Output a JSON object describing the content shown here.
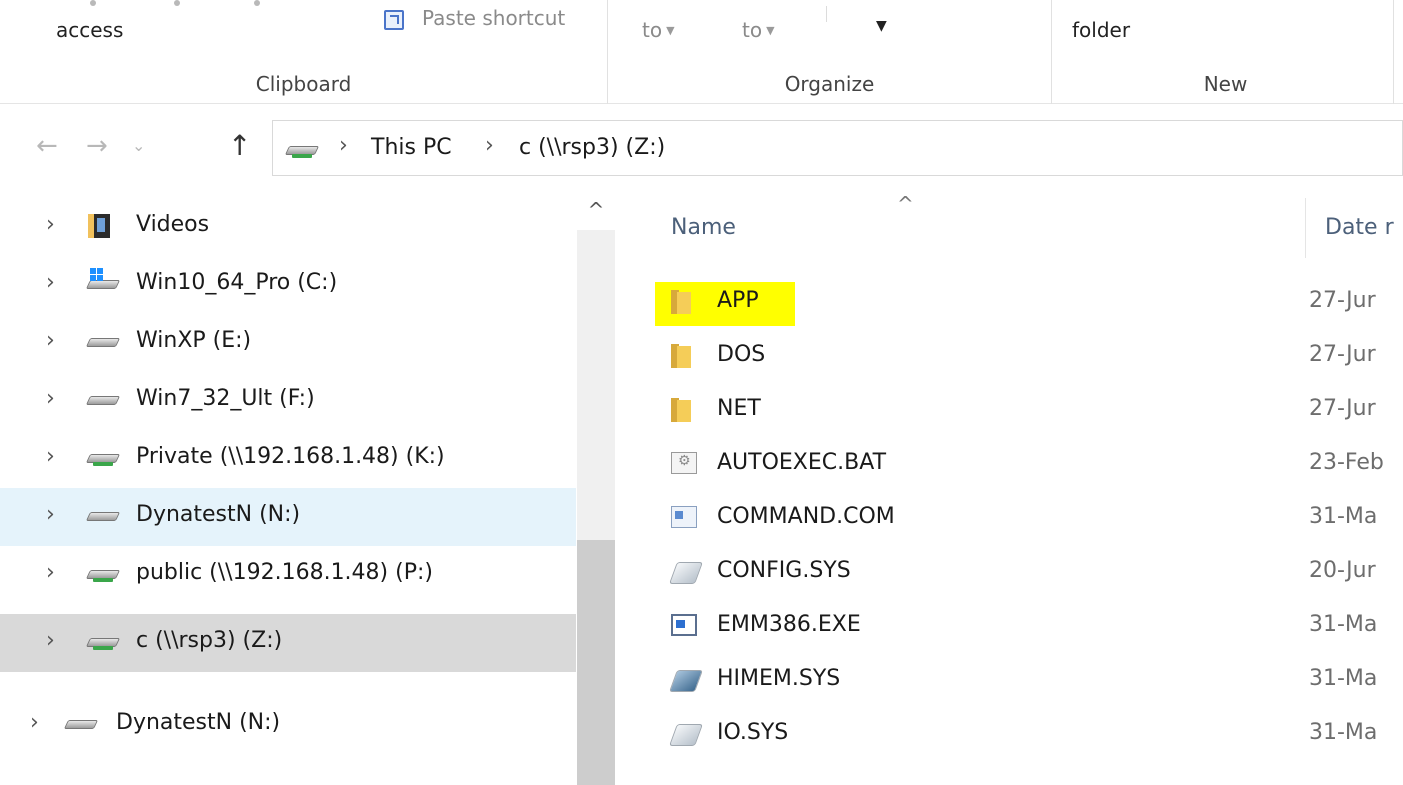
{
  "ribbon": {
    "clipboard": {
      "access_label": "access",
      "paste_shortcut_label": "Paste shortcut",
      "group_label": "Clipboard"
    },
    "organize": {
      "move_to_label": "to",
      "copy_to_label": "to",
      "group_label": "Organize"
    },
    "new": {
      "new_folder_label": "folder",
      "group_label": "New"
    }
  },
  "address": {
    "crumbs": [
      "This PC",
      "c (\\\\rsp3) (Z:)"
    ]
  },
  "nav_tree": [
    {
      "label": "Videos",
      "icon": "videos-icon"
    },
    {
      "label": "Win10_64_Pro (C:)",
      "icon": "windows-drive-icon"
    },
    {
      "label": "WinXP (E:)",
      "icon": "drive-icon"
    },
    {
      "label": "Win7_32_Ult (F:)",
      "icon": "drive-icon"
    },
    {
      "label": "Private (\\\\192.168.1.48) (K:)",
      "icon": "network-drive-icon"
    },
    {
      "label": "DynatestN (N:)",
      "icon": "drive-icon"
    },
    {
      "label": "public (\\\\192.168.1.48) (P:)",
      "icon": "network-drive-icon"
    },
    {
      "label": "c (\\\\rsp3) (Z:)",
      "icon": "network-drive-icon"
    },
    {
      "label": "DynatestN (N:)",
      "icon": "drive-icon"
    }
  ],
  "columns": {
    "name": "Name",
    "date": "Date r"
  },
  "files": [
    {
      "name": "APP",
      "date": "27-Jur",
      "icon": "folder-icon"
    },
    {
      "name": "DOS",
      "date": "27-Jur",
      "icon": "folder-icon"
    },
    {
      "name": "NET",
      "date": "27-Jur",
      "icon": "folder-icon"
    },
    {
      "name": "AUTOEXEC.BAT",
      "date": "23-Feb",
      "icon": "batch-file-icon"
    },
    {
      "name": "COMMAND.COM",
      "date": "31-Ma",
      "icon": "application-icon"
    },
    {
      "name": "CONFIG.SYS",
      "date": "20-Jur",
      "icon": "system-file-icon"
    },
    {
      "name": "EMM386.EXE",
      "date": "31-Ma",
      "icon": "application-icon"
    },
    {
      "name": "HIMEM.SYS",
      "date": "31-Ma",
      "icon": "system-file-icon"
    },
    {
      "name": "IO.SYS",
      "date": "31-Ma",
      "icon": "system-file-icon"
    }
  ],
  "colors": {
    "highlight": "#ffff00",
    "hover_row": "#e5f3fb",
    "selected_row": "#d9d9d9"
  }
}
